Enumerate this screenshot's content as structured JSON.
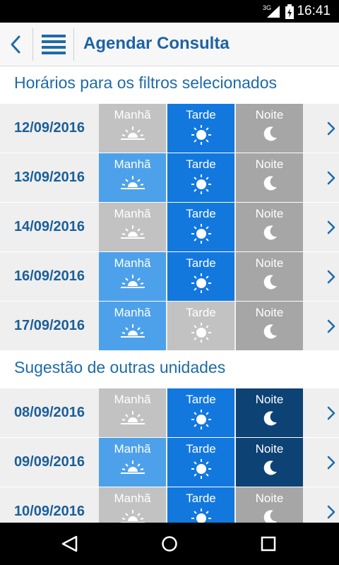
{
  "status_bar": {
    "network": "3G",
    "time": "16:41"
  },
  "app_bar": {
    "title": "Agendar Consulta"
  },
  "periods": {
    "morning": "Manhã",
    "afternoon": "Tarde",
    "night": "Noite"
  },
  "sections": [
    {
      "title": "Horários para os filtros selecionados",
      "rows": [
        {
          "date": "12/09/2016",
          "morning": "off",
          "afternoon": "available",
          "night": "off"
        },
        {
          "date": "13/09/2016",
          "morning": "available",
          "afternoon": "available",
          "night": "off"
        },
        {
          "date": "14/09/2016",
          "morning": "off",
          "afternoon": "available",
          "night": "off"
        },
        {
          "date": "16/09/2016",
          "morning": "available",
          "afternoon": "available",
          "night": "off"
        },
        {
          "date": "17/09/2016",
          "morning": "available",
          "afternoon": "off",
          "night": "off"
        }
      ]
    },
    {
      "title": "Sugestão de outras unidades",
      "rows": [
        {
          "date": "08/09/2016",
          "morning": "off",
          "afternoon": "available",
          "night": "available"
        },
        {
          "date": "09/09/2016",
          "morning": "available",
          "afternoon": "available",
          "night": "available"
        },
        {
          "date": "10/09/2016",
          "morning": "off",
          "afternoon": "available",
          "night": "off"
        }
      ]
    }
  ],
  "colors": {
    "morning_available": "#4da1ea",
    "afternoon_available": "#1278de",
    "night_available": "#0d4275",
    "unavailable_light": "#c2c2c2",
    "unavailable_dark": "#a6a6a6",
    "accent_text": "#1e63a3"
  }
}
